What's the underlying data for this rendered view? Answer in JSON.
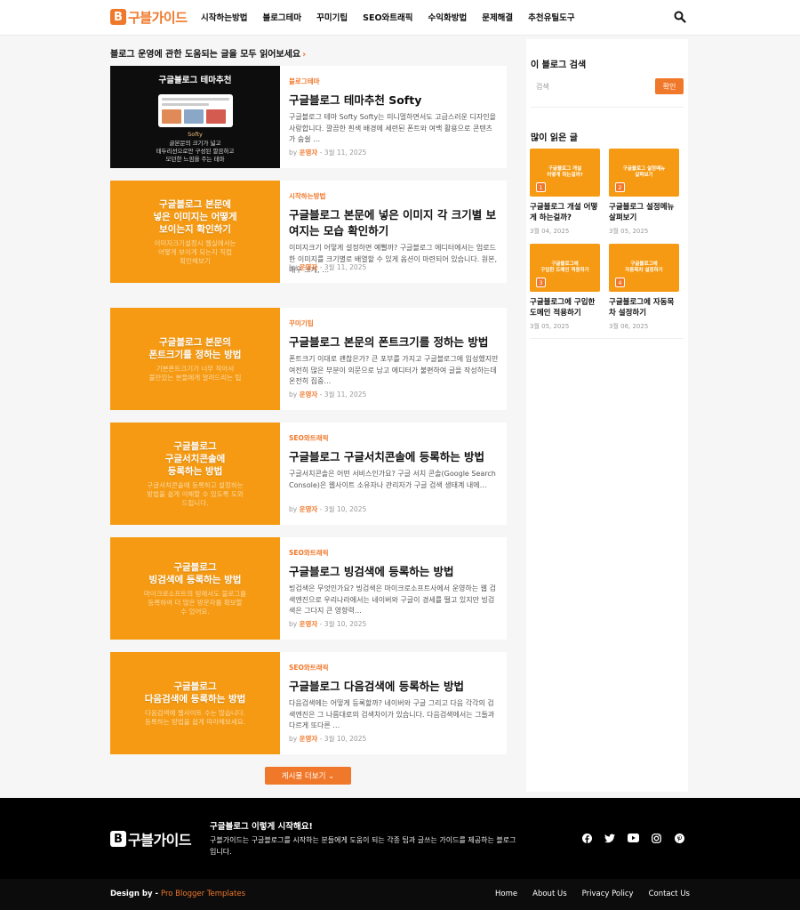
{
  "brand": {
    "logo_mark": "B",
    "logo_text": "구블가이드",
    "accent_color": "#f0782a",
    "thumb_color": "#f59a12"
  },
  "nav": {
    "items": [
      "시작하는방법",
      "블로그테마",
      "꾸미기팁",
      "SEO와트래픽",
      "수익화방법",
      "문제해결",
      "추천유틸도구"
    ]
  },
  "main": {
    "heading": "블로그 운영에 관한 도움되는 글을 모두 읽어보세요",
    "heading_icon": "chevron-right-icon",
    "posts": [
      {
        "thumb_title": "구글블로그 테마추천",
        "thumb_sub": "Softy",
        "thumb_desc": "글본문의 크기가 넓고\n테두리선으로만 구성된 깔끔하고\n모던한 느낌을 주는 테마",
        "category": "블로그테마",
        "title": "구글블로그 테마추천 Softy",
        "excerpt": "구글블로그 테마 Softy Softy는 미니멀하면서도 고급스러운 디자인을 사랑합니다. 깔끔한 흰색 배경에 세련된 폰트와 여백 활용으로 콘텐츠가 숨쉴 …",
        "author": "운영자",
        "date": "3월 11, 2025"
      },
      {
        "thumb_title": "구글블로그 본문에\n넣은 이미지는 어떻게\n보이는지 확인하기",
        "thumb_sub": "이미지크기설정시 웹실에서는\n어떻게 보이게 되는지 직접\n확인해보기",
        "category": "시작하는방법",
        "title": "구글블로그 본문에 넣은 이미지 각 크기별 보여지는 모습 확인하기",
        "excerpt": "이미지크기 어떻게 설정하면 예뻘까? 구글블로그 에디터에서는 업로드한 이미지를 크기별로 배열할 수 있게 옵션이 마련되어 있습니다. 원본, 매우 크게, …",
        "author": "운영자",
        "date": "3월 11, 2025"
      },
      {
        "thumb_title": "구글블로그 본문의\n폰트크기를 정하는 방법",
        "thumb_sub": "기본폰트크기가 너무 작아서\n불만있는 분들에게 알려드리는 팁",
        "category": "꾸미기팁",
        "title": "구글블로그 본문의 폰트크기를 정하는 방법",
        "excerpt": "폰트크기 이대로 괜찮은가? 큰 포부를 가지고 구글블로그에 입성했지만 여전히 많은 부분이 의문으로 남고 에디터가 불편하여 글을 작성하는데 온전히 집중…",
        "author": "운영자",
        "date": "3월 11, 2025"
      },
      {
        "thumb_title": "구글블로그\n구글서치콘솔에\n등록하는 방법",
        "thumb_sub": "구글서치콘솔에 등록하고 설정하는\n방법을 쉽게 이해할 수 있도록 도와\n드립니다.",
        "category": "SEO와트래픽",
        "title": "구글블로그 구글서치콘솔에 등록하는 방법",
        "excerpt": "구글서치콘솔은 어떤 서비스인가요? 구글 서치 콘솔(Google Search Console)은 웹사이트 소유자나 관리자가 구글 검색 생태계 내에…",
        "author": "운영자",
        "date": "3월 10, 2025"
      },
      {
        "thumb_title": "구글블로그\n빙검색에 등록하는 방법",
        "thumb_sub": "마이크로소프트의 빙에서도 블로그를\n등록하여 더 많은 방문자를 확보할\n수 있어요.",
        "category": "SEO와트래픽",
        "title": "구글블로그 빙검색에 등록하는 방법",
        "excerpt": "빙검색은 무엇인가요? 빙검색은 마이크로소프트사에서 운영하는 웹 검색엔진으로 우리나라에서는 네이버와 구글이 경세를 떨고 있지만 빙검색은 그다지 큰 영향력…",
        "author": "운영자",
        "date": "3월 10, 2025"
      },
      {
        "thumb_title": "구글블로그\n다음검색에 등록하는 방법",
        "thumb_sub": "다음검색에 웹사이트 수는 많습니다.\n등록하는 방법을 쉽게 따라해보세요.",
        "category": "SEO와트래픽",
        "title": "구글블로그 다음검색에 등록하는 방법",
        "excerpt": "다음검색에는 어떻게 등록할까? 네이버와 구글 그리고 다음 각각의 검색엔진은 그 나름대로의 검색차이가 있습니다. 다음검색에서는 그들과 다르게 또다른 …",
        "author": "운영자",
        "date": "3월 10, 2025"
      }
    ],
    "by_label": "by",
    "meta_sep": "-",
    "more_button": "게시물 더보기"
  },
  "sidebar": {
    "search_heading": "이 블로그 검색",
    "search_placeholder": "검색",
    "search_button": "확인",
    "popular_heading": "많이 읽은 글",
    "popular": [
      {
        "num": "1",
        "thumb": "구글블로그 개설\n어떻게 하는걸까?",
        "title": "구글블로그 개설 어떻게 하는걸까?",
        "date": "3월 04, 2025"
      },
      {
        "num": "2",
        "thumb": "구글블로그 설정메뉴\n살펴보기",
        "title": "구글블로그 설정메뉴 살펴보기",
        "date": "3월 05, 2025"
      },
      {
        "num": "3",
        "thumb": "구글블로그에\n구입한 도메인 적용하기",
        "title": "구글블로그에 구입한 도메인 적용하기",
        "date": "3월 05, 2025"
      },
      {
        "num": "4",
        "thumb": "구글블로그에\n자동목차 설정하기",
        "title": "구글블로그에 자동목차 설정하기",
        "date": "3월 06, 2025"
      }
    ]
  },
  "footer": {
    "title": "구글블로그 이렇게 시작해요!",
    "description": "구블가이드는 구글블로그를 시작하는 분들에게 도움이 되는 각종 팁과 글쓰는 가이드를 제공하는 블로그입니다.",
    "social_icons": [
      "facebook-icon",
      "twitter-icon",
      "youtube-icon",
      "instagram-icon",
      "pinterest-icon"
    ],
    "design_label": "Design by -",
    "design_link": "Pro Blogger Templates",
    "links": [
      "Home",
      "About Us",
      "Privacy Policy",
      "Contact Us"
    ]
  }
}
